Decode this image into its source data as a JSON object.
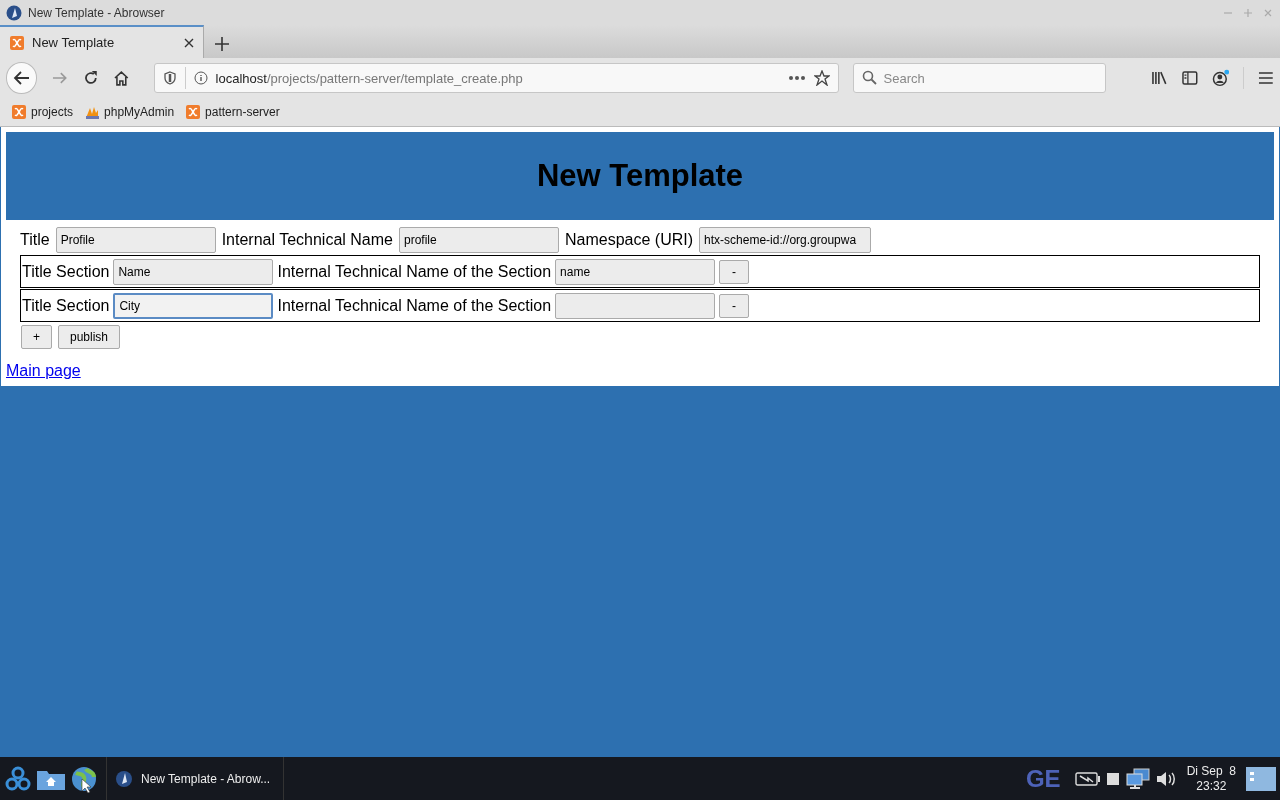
{
  "window": {
    "title": "New Template - Abrowser"
  },
  "tabs": [
    {
      "label": "New Template",
      "selected": true
    }
  ],
  "address_bar": {
    "host": "localhost",
    "path": "/projects/pattern-server/template_create.php"
  },
  "search": {
    "placeholder": "Search"
  },
  "bookmarks": [
    {
      "label": "projects",
      "kind": "xampp"
    },
    {
      "label": "phpMyAdmin",
      "kind": "pma"
    },
    {
      "label": "pattern-server",
      "kind": "xampp"
    }
  ],
  "page": {
    "heading": "New Template",
    "fields": [
      {
        "label": "Title",
        "value": "Profile"
      },
      {
        "label": "Internal Technical Name",
        "value": "profile"
      },
      {
        "label": "Namespace (URI)",
        "value": "htx-scheme-id://org.groupwa"
      }
    ],
    "sections": [
      {
        "title_label": "Title Section",
        "title_value": "Name",
        "name_label": "Internal Technical Name of the Section",
        "name_value": "name",
        "remove_button": "-",
        "focused": false
      },
      {
        "title_label": "Title Section",
        "title_value": "City",
        "name_label": "Internal Technical Name of the Section",
        "remove_button": "-",
        "focused": true
      }
    ],
    "buttons": [
      "+",
      "publish"
    ],
    "link": "Main page"
  },
  "taskbar": {
    "window_button": "New Template - Abrow...",
    "keyboard_layout": "GE",
    "clock_day": "Di Sep  8",
    "clock_time": "23:32"
  }
}
